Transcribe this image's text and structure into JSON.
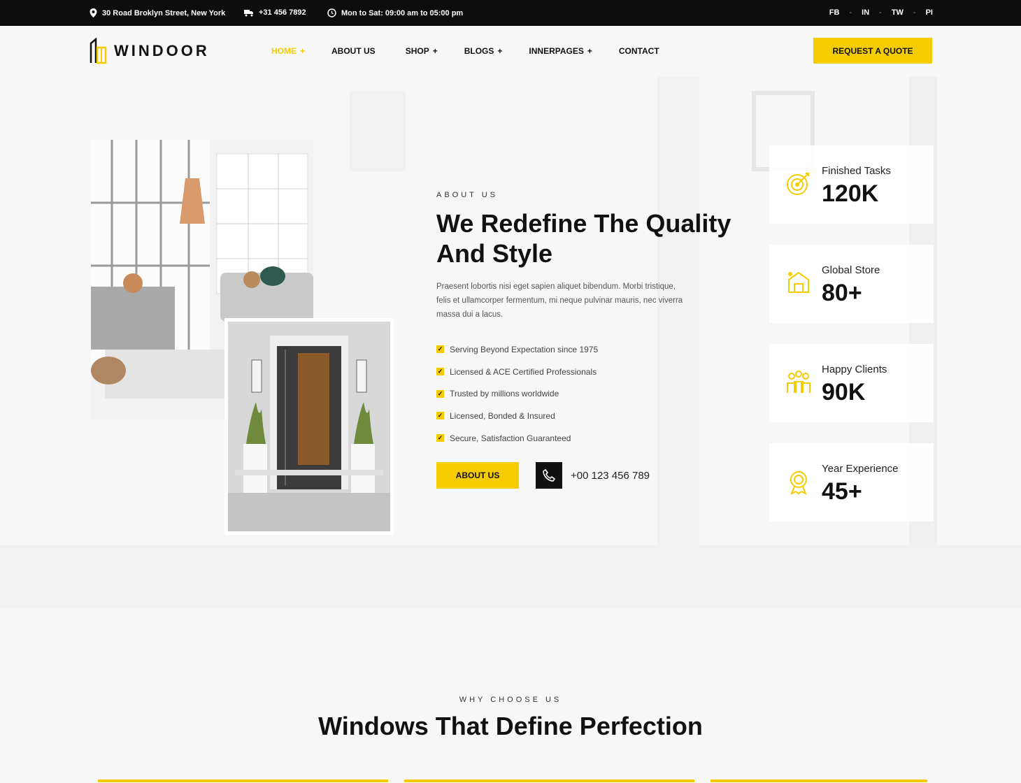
{
  "topbar": {
    "address": "30 Road Broklyn Street, New York",
    "phone": "+31 456 7892",
    "hours": "Mon to Sat: 09:00 am to 05:00 pm",
    "socials": [
      "FB",
      "IN",
      "TW",
      "PI"
    ]
  },
  "header": {
    "logo_text": "WINDOOR",
    "nav": [
      {
        "label": "HOME",
        "suffix": "+"
      },
      {
        "label": "ABOUT US",
        "suffix": ""
      },
      {
        "label": "SHOP",
        "suffix": "+"
      },
      {
        "label": "BLOGS",
        "suffix": "+"
      },
      {
        "label": "INNERPAGES",
        "suffix": "+"
      },
      {
        "label": "CONTACT",
        "suffix": ""
      }
    ],
    "cta_label": "REQUEST A QUOTE"
  },
  "about": {
    "kicker": "ABOUT US",
    "title": "We Redefine The Quality And Style",
    "description": "Praesent lobortis nisi eget sapien aliquet bibendum. Morbi tristique, felis et ullamcorper fermentum, mi neque pulvinar mauris, nec viverra massa dui a lacus.",
    "checklist": [
      "Serving Beyond Expectation since 1975",
      "Licensed & ACE Certified Professionals",
      "Trusted by millions worldwide",
      "Licensed, Bonded & Insured",
      "Secure, Satisfaction Guaranteed"
    ],
    "button_label": "ABOUT US",
    "phone": "+00 123 456 789"
  },
  "stats": [
    {
      "label": "Finished Tasks",
      "value": "120K",
      "icon": "target-icon"
    },
    {
      "label": "Global Store",
      "value": "80+",
      "icon": "store-icon"
    },
    {
      "label": "Happy Clients",
      "value": "90K",
      "icon": "clients-icon"
    },
    {
      "label": "Year Experience",
      "value": "45+",
      "icon": "award-icon"
    }
  ],
  "why": {
    "kicker": "WHY CHOOSE US",
    "title": "Windows That Define Perfection"
  },
  "colors": {
    "accent": "#f5cc00",
    "dark": "#0d0d0d"
  }
}
